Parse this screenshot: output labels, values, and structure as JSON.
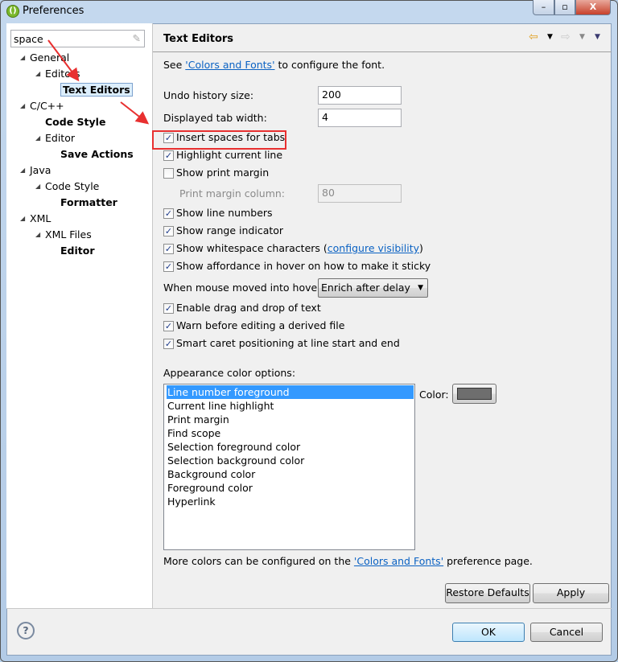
{
  "window": {
    "title": "Preferences"
  },
  "search": {
    "value": "space"
  },
  "tree": [
    {
      "label": "General",
      "level": 0,
      "bold": false
    },
    {
      "label": "Editors",
      "level": 1,
      "bold": false
    },
    {
      "label": "Text Editors",
      "level": 2,
      "bold": true,
      "selected": true
    },
    {
      "label": "C/C++",
      "level": 0,
      "bold": false
    },
    {
      "label": "Code Style",
      "level": 1,
      "bold": true
    },
    {
      "label": "Editor",
      "level": 1,
      "bold": false
    },
    {
      "label": "Save Actions",
      "level": 2,
      "bold": true
    },
    {
      "label": "Java",
      "level": 0,
      "bold": false
    },
    {
      "label": "Code Style",
      "level": 1,
      "bold": false
    },
    {
      "label": "Formatter",
      "level": 2,
      "bold": true
    },
    {
      "label": "XML",
      "level": 0,
      "bold": false
    },
    {
      "label": "XML Files",
      "level": 1,
      "bold": false
    },
    {
      "label": "Editor",
      "level": 2,
      "bold": true
    }
  ],
  "page": {
    "title": "Text Editors",
    "intro_pre": "See ",
    "intro_link": "'Colors and Fonts'",
    "intro_post": " to configure the font.",
    "undo_label": "Undo history size:",
    "undo_value": "200",
    "tab_label": "Displayed tab width:",
    "tab_value": "4",
    "checks1": [
      {
        "label": "Insert spaces for tabs",
        "checked": true
      },
      {
        "label": "Highlight current line",
        "checked": true
      },
      {
        "label": "Show print margin",
        "checked": false
      }
    ],
    "margin_label": "Print margin column:",
    "margin_value": "80",
    "checks2": [
      {
        "label": "Show line numbers",
        "checked": true
      },
      {
        "label": "Show range indicator",
        "checked": true
      },
      {
        "label": "Show whitespace characters (",
        "link": "configure visibility",
        "post": ")",
        "checked": true
      },
      {
        "label": "Show affordance in hover on how to make it sticky",
        "checked": true
      }
    ],
    "hover_label": "When mouse moved into hover:",
    "hover_value": "Enrich after delay",
    "checks3": [
      {
        "label": "Enable drag and drop of text",
        "checked": true
      },
      {
        "label": "Warn before editing a derived file",
        "checked": true
      },
      {
        "label": "Smart caret positioning at line start and end",
        "checked": true
      }
    ],
    "appearance_label": "Appearance color options:",
    "color_options": [
      "Line number foreground",
      "Current line highlight",
      "Print margin",
      "Find scope",
      "Selection foreground color",
      "Selection background color",
      "Background color",
      "Foreground color",
      "Hyperlink"
    ],
    "color_label": "Color:",
    "color_value": "#6e6e6e",
    "more_pre": "More colors can be configured on the ",
    "more_link": "'Colors and Fonts'",
    "more_post": " preference page.",
    "restore": "Restore Defaults",
    "apply": "Apply"
  },
  "footer": {
    "ok": "OK",
    "cancel": "Cancel"
  },
  "annotation_color": "#e83030"
}
